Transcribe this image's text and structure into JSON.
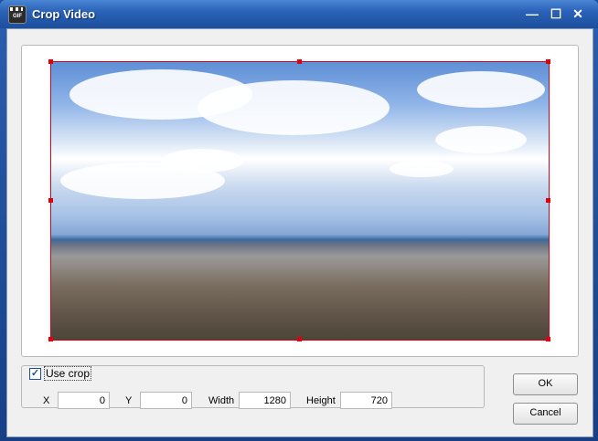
{
  "window": {
    "title": "Crop Video",
    "app_icon_text": "GIF",
    "controls": {
      "minimize": "—",
      "maximize": "☐",
      "close": "✕"
    }
  },
  "crop": {
    "use_crop_label": "Use crop",
    "checked_mark": "✓",
    "fields": {
      "x_label": "X",
      "x_value": "0",
      "y_label": "Y",
      "y_value": "0",
      "width_label": "Width",
      "width_value": "1280",
      "height_label": "Height",
      "height_value": "720"
    }
  },
  "buttons": {
    "ok": "OK",
    "cancel": "Cancel"
  },
  "colors": {
    "selection_border": "#e00010",
    "title_bar": "#2a62b8"
  }
}
